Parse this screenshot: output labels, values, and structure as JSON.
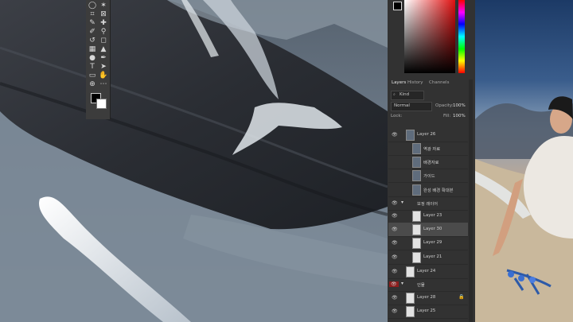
{
  "panel": {
    "tabs": [
      "Layers",
      "History",
      "Channels"
    ],
    "filter_label": "Kind",
    "blend_mode": "Normal",
    "opacity_label": "Opacity:",
    "opacity_value": "100%",
    "lock_label": "Lock:",
    "fill_label": "Fill:",
    "fill_value": "100%",
    "layers": [
      {
        "name": "Layer 26"
      },
      {
        "name": "역광 자료"
      },
      {
        "name": "배경자료"
      },
      {
        "name": "가이드"
      },
      {
        "name": "완성 배경 확대본"
      },
      {
        "name": "보정 레이어"
      },
      {
        "name": "Layer 23"
      },
      {
        "name": "Layer 30"
      },
      {
        "name": "Layer 29"
      },
      {
        "name": "Layer 21"
      },
      {
        "name": "Layer 24"
      },
      {
        "name": "인물"
      },
      {
        "name": "Layer 28"
      },
      {
        "name": "Layer 25"
      }
    ]
  },
  "colors": {
    "accent": "#e01010",
    "panel_bg": "#323232",
    "selected_row": "#4b4b4b"
  },
  "tool_icons": [
    "lasso-icon",
    "magic-wand-icon",
    "crop-icon",
    "frame-icon",
    "eyedropper-icon",
    "healing-icon",
    "brush-icon",
    "stamp-icon",
    "history-brush-icon",
    "eraser-icon",
    "gradient-icon",
    "blur-icon",
    "dodge-icon",
    "pen-icon",
    "type-icon",
    "path-select-icon",
    "shape-icon",
    "hand-icon",
    "zoom-icon",
    "more-icon"
  ]
}
